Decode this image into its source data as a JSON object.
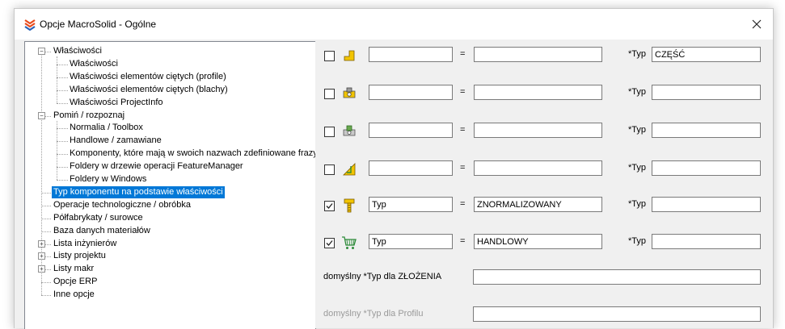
{
  "window": {
    "title": "Opcje MacroSolid - Ogólne",
    "title_icon": "macrosolid-logo-icon",
    "close_icon": "close-icon"
  },
  "tree": {
    "items": [
      {
        "label": "Właściwości",
        "level": 0,
        "expander": "minus"
      },
      {
        "label": "Właściwości",
        "level": 1
      },
      {
        "label": "Właściwości elementów ciętych (profile)",
        "level": 1
      },
      {
        "label": "Właściwości elementów ciętych (blachy)",
        "level": 1
      },
      {
        "label": "Właściwości ProjectInfo",
        "level": 1
      },
      {
        "label": "Pomiń / rozpoznaj",
        "level": 0,
        "expander": "minus"
      },
      {
        "label": "Normalia / Toolbox",
        "level": 1
      },
      {
        "label": "Handlowe / zamawiane",
        "level": 1
      },
      {
        "label": "Komponenty, które mają w swoich nazwach zdefiniowane frazy",
        "level": 1
      },
      {
        "label": "Foldery w drzewie operacji FeatureManager",
        "level": 1
      },
      {
        "label": "Foldery w Windows",
        "level": 1
      },
      {
        "label": "Typ komponentu na podstawie właściwości",
        "level": 0,
        "selected": true
      },
      {
        "label": "Operacje technologiczne / obróbka",
        "level": 0
      },
      {
        "label": "Półfabrykaty / surowce",
        "level": 0
      },
      {
        "label": "Baza danych materiałów",
        "level": 0
      },
      {
        "label": "Lista inżynierów",
        "level": 0,
        "expander": "plus"
      },
      {
        "label": "Listy projektu",
        "level": 0,
        "expander": "plus"
      },
      {
        "label": "Listy makr",
        "level": 0,
        "expander": "plus"
      },
      {
        "label": "Opcje ERP",
        "level": 0
      },
      {
        "label": "Inne opcje",
        "level": 0
      }
    ]
  },
  "rules": [
    {
      "checked": false,
      "icon": "part-icon",
      "property": "",
      "equals": "=",
      "value": "",
      "type_label": "*Typ",
      "type_value": "CZĘŚĆ"
    },
    {
      "checked": false,
      "icon": "profile-part-icon",
      "property": "",
      "equals": "=",
      "value": "",
      "type_label": "*Typ",
      "type_value": ""
    },
    {
      "checked": false,
      "icon": "weldment-part-icon",
      "property": "",
      "equals": "=",
      "value": "",
      "type_label": "*Typ",
      "type_value": ""
    },
    {
      "checked": false,
      "icon": "sheet-metal-icon",
      "property": "",
      "equals": "=",
      "value": "",
      "type_label": "*Typ",
      "type_value": ""
    },
    {
      "checked": true,
      "icon": "toolbox-bolt-icon",
      "property": "Typ",
      "equals": "=",
      "value": "ZNORMALIZOWANY",
      "type_label": "*Typ",
      "type_value": ""
    },
    {
      "checked": true,
      "icon": "shopping-cart-icon",
      "property": "Typ",
      "equals": "=",
      "value": "HANDLOWY",
      "type_label": "*Typ",
      "type_value": ""
    }
  ],
  "defaults": [
    {
      "label": "domyślny *Typ dla ZŁOŻENIA",
      "value": ""
    },
    {
      "label": "domyślny *Typ dla Profilu",
      "value": ""
    }
  ],
  "colors": {
    "selection": "#0078d7",
    "icon_yellow": "#f2c400",
    "icon_green": "#2e8b3a"
  }
}
